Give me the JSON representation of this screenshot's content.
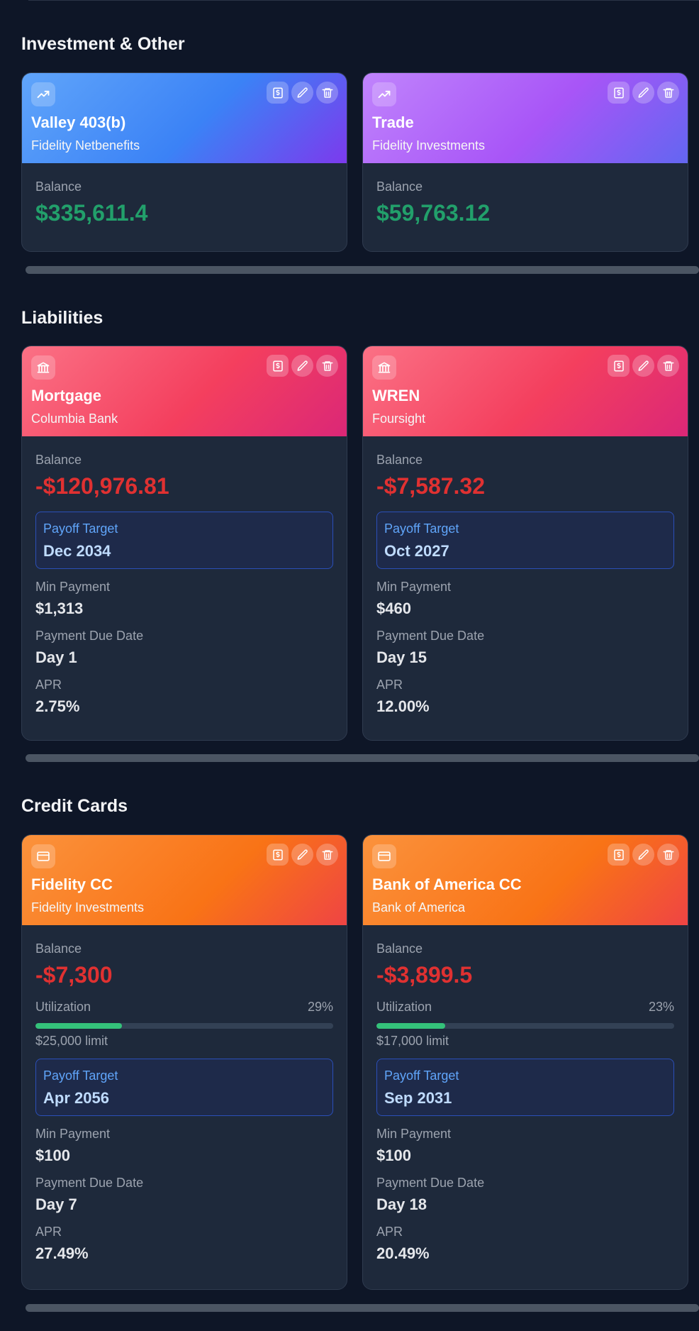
{
  "sections": {
    "investment": {
      "title": "Investment & Other",
      "cards": [
        {
          "name": "Valley 403(b)",
          "institution": "Fidelity Netbenefits",
          "balance_label": "Balance",
          "balance": "$335,611.4",
          "icon": "trending-up-icon"
        },
        {
          "name": "Trade",
          "institution": "Fidelity Investments",
          "balance_label": "Balance",
          "balance": "$59,763.12",
          "icon": "trending-up-icon"
        }
      ]
    },
    "liabilities": {
      "title": "Liabilities",
      "cards": [
        {
          "name": "Mortgage",
          "institution": "Columbia Bank",
          "balance_label": "Balance",
          "balance": "-$120,976.81",
          "payoff_label": "Payoff Target",
          "payoff": "Dec 2034",
          "min_payment_label": "Min Payment",
          "min_payment": "$1,313",
          "due_label": "Payment Due Date",
          "due": "Day 1",
          "apr_label": "APR",
          "apr": "2.75%",
          "icon": "bank-icon"
        },
        {
          "name": "WREN",
          "institution": "Foursight",
          "balance_label": "Balance",
          "balance": "-$7,587.32",
          "payoff_label": "Payoff Target",
          "payoff": "Oct 2027",
          "min_payment_label": "Min Payment",
          "min_payment": "$460",
          "due_label": "Payment Due Date",
          "due": "Day 15",
          "apr_label": "APR",
          "apr": "12.00%",
          "icon": "bank-icon"
        }
      ]
    },
    "credit": {
      "title": "Credit Cards",
      "cards": [
        {
          "name": "Fidelity CC",
          "institution": "Fidelity Investments",
          "balance_label": "Balance",
          "balance": "-$7,300",
          "util_label": "Utilization",
          "util_pct": "29%",
          "util_value": 0.29,
          "limit": "$25,000 limit",
          "payoff_label": "Payoff Target",
          "payoff": "Apr 2056",
          "min_payment_label": "Min Payment",
          "min_payment": "$100",
          "due_label": "Payment Due Date",
          "due": "Day 7",
          "apr_label": "APR",
          "apr": "27.49%",
          "icon": "credit-card-icon"
        },
        {
          "name": "Bank of America CC",
          "institution": "Bank of America",
          "balance_label": "Balance",
          "balance": "-$3,899.5",
          "util_label": "Utilization",
          "util_pct": "23%",
          "util_value": 0.23,
          "limit": "$17,000 limit",
          "payoff_label": "Payoff Target",
          "payoff": "Sep 2031",
          "min_payment_label": "Min Payment",
          "min_payment": "$100",
          "due_label": "Payment Due Date",
          "due": "Day 18",
          "apr_label": "APR",
          "apr": "20.49%",
          "icon": "credit-card-icon"
        }
      ]
    }
  },
  "colors": {
    "positive": "#22a06b",
    "negative": "#e03131",
    "accent_blue": "#60a5fa",
    "util_fill": "#34c27a"
  },
  "icons": {
    "actions": [
      "payment-icon",
      "edit-icon",
      "delete-icon"
    ]
  }
}
